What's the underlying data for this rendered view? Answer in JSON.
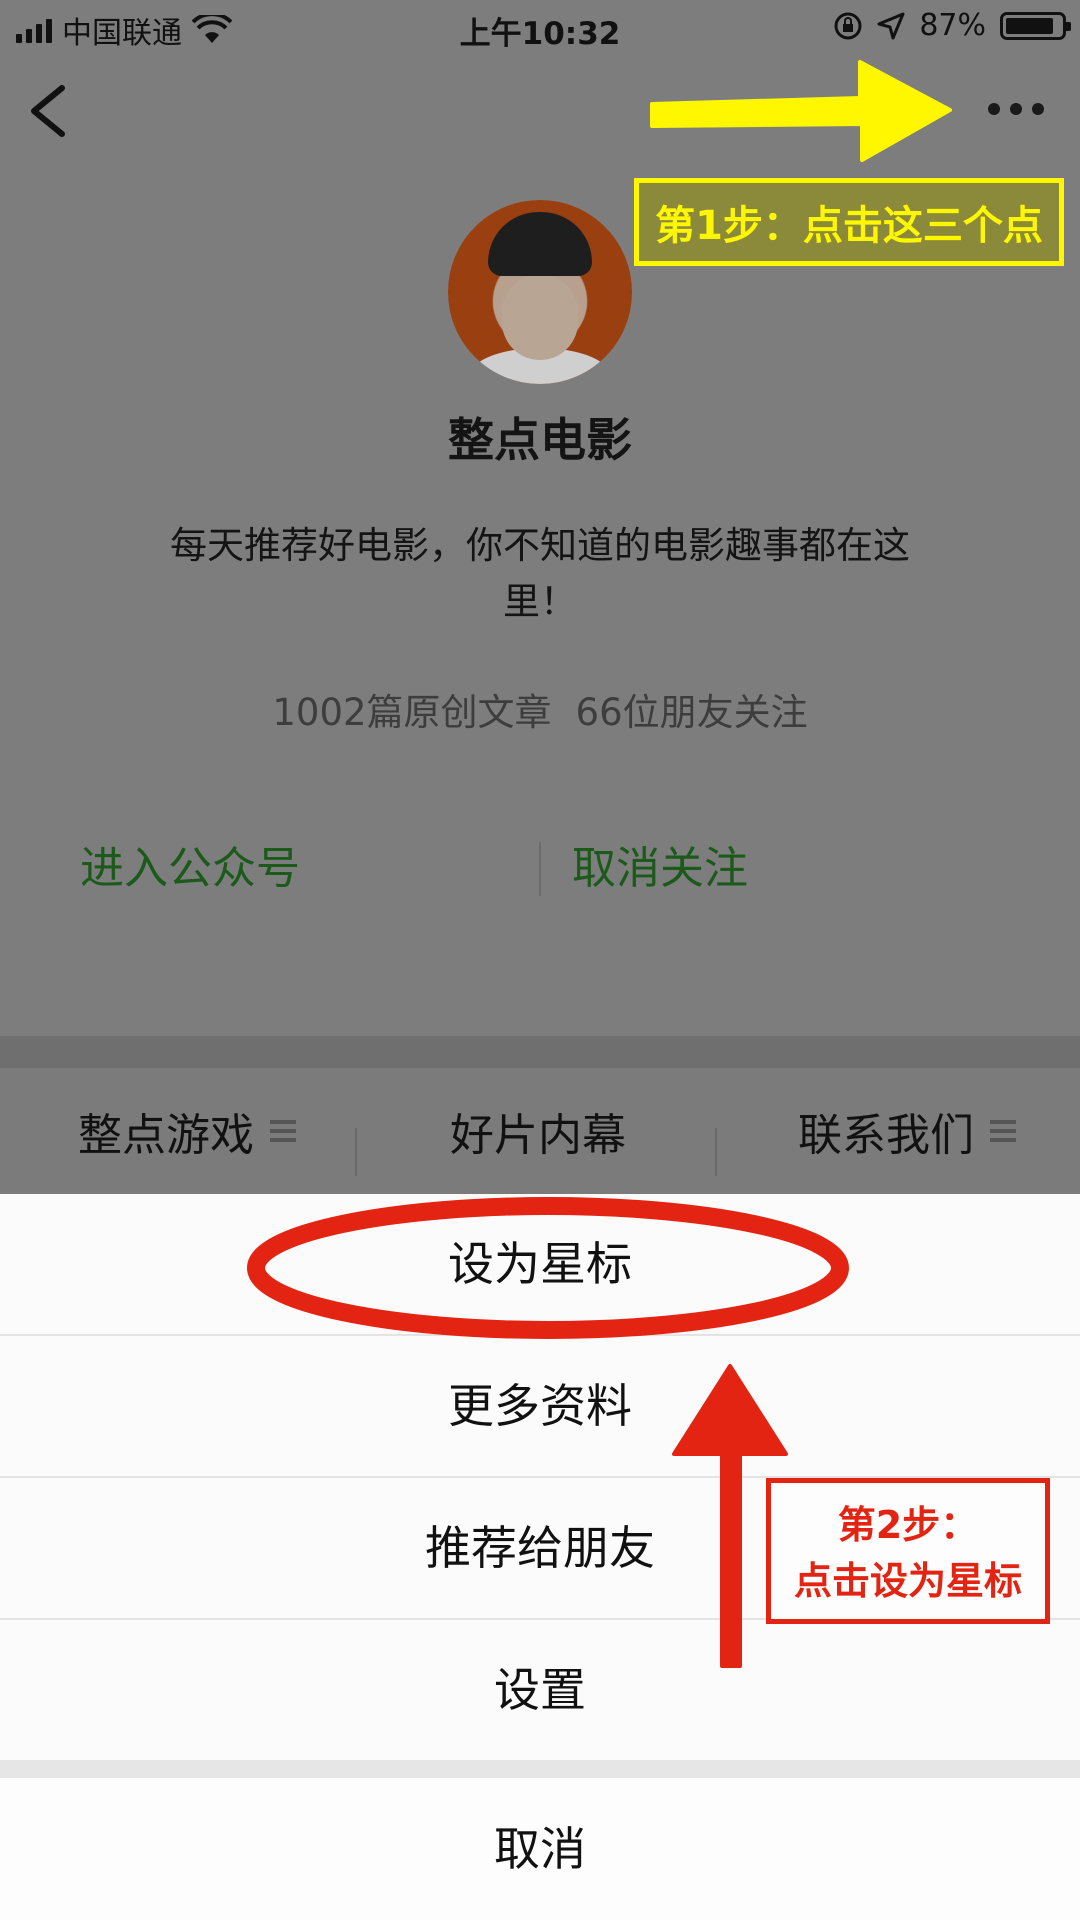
{
  "status_bar": {
    "carrier": "中国联通",
    "time": "上午10:32",
    "battery": "87%",
    "battery_level": 0.87
  },
  "profile": {
    "name": "整点电影",
    "description": "每天推荐好电影，你不知道的电影趣事都在这里！",
    "stats": {
      "articles": "1002篇原创文章",
      "friends": "66位朋友关注"
    },
    "actions": {
      "enter": "进入公众号",
      "unfollow": "取消关注"
    }
  },
  "menu_bar": {
    "items": [
      "整点游戏",
      "好片内幕",
      "联系我们"
    ]
  },
  "action_sheet": {
    "items": [
      "设为星标",
      "更多资料",
      "推荐给朋友",
      "设置"
    ],
    "cancel": "取消"
  },
  "annotations": {
    "step1": "第1步：点击这三个点",
    "step2_line1": "第2步：",
    "step2_line2": "点击设为星标",
    "colors": {
      "step1": "#fff700",
      "step2": "#e32412"
    }
  },
  "colors": {
    "follow_green": "#1c5a1c",
    "dim_background": "#7d7d7d",
    "sheet_background": "#fbfbfb"
  }
}
